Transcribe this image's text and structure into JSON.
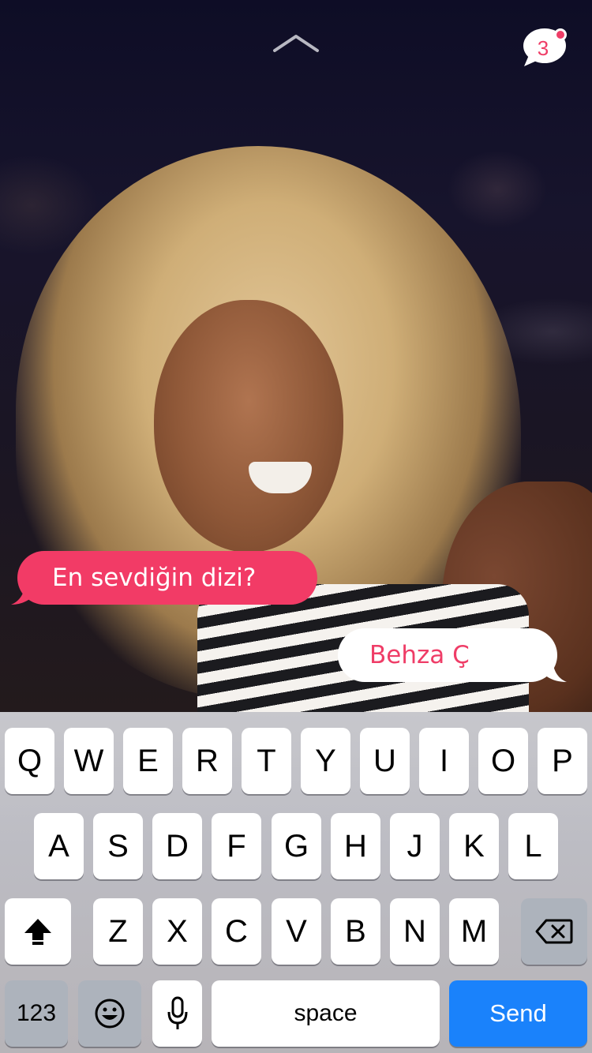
{
  "chat": {
    "unread_count": "3",
    "question": "En sevdiğin dizi?",
    "answer_name": "Behza Ç"
  },
  "icons": {
    "expand": "chevron-up-icon",
    "chat": "chat-bubble-icon",
    "shift": "shift-arrow-icon",
    "delete": "backspace-icon",
    "emoji": "emoji-icon",
    "mic": "microphone-icon"
  },
  "keyboard": {
    "row1": [
      "Q",
      "W",
      "E",
      "R",
      "T",
      "Y",
      "U",
      "I",
      "O",
      "P"
    ],
    "row2": [
      "A",
      "S",
      "D",
      "F",
      "G",
      "H",
      "J",
      "K",
      "L"
    ],
    "row3": [
      "Z",
      "X",
      "C",
      "V",
      "B",
      "N",
      "M"
    ],
    "numbers_label": "123",
    "space_label": "space",
    "send_label": "Send"
  },
  "colors": {
    "accent": "#f23b66",
    "send_button": "#1a82fb",
    "keyboard_bg": "#c7c7cc"
  }
}
